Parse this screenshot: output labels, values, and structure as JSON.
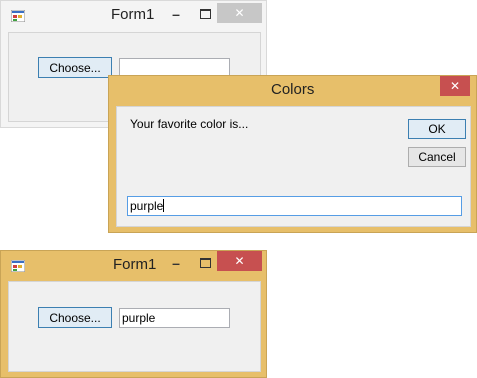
{
  "form1_back": {
    "title": "Form1",
    "choose_label": "Choose...",
    "textbox_value": "",
    "minimize_glyph": "–",
    "maximize_glyph": "□",
    "close_glyph": "✕"
  },
  "colors_dialog": {
    "title": "Colors",
    "prompt": "Your favorite color is...",
    "ok_label": "OK",
    "cancel_label": "Cancel",
    "input_value": "purple",
    "close_glyph": "✕"
  },
  "form1_front": {
    "title": "Form1",
    "choose_label": "Choose...",
    "textbox_value": "purple",
    "minimize_glyph": "–",
    "maximize_glyph": "□",
    "close_glyph": "✕"
  },
  "colors": {
    "inactive_frame": "#f4f4f4",
    "active_frame": "#e7bf6a",
    "active_close": "#c75050",
    "inactive_close": "#c7c7c7"
  }
}
